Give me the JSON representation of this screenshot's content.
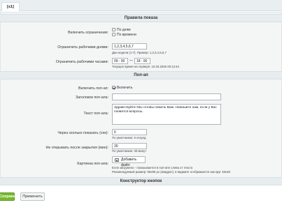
{
  "tab": {
    "label": "[s1]"
  },
  "sections": {
    "display_rules": "Правила показа",
    "popup": "Поп-ап",
    "buttons": "Конструктор кнопок"
  },
  "restrictions": {
    "label": "Включить ограничения:",
    "options": [
      {
        "label": "По дням",
        "checked": false
      },
      {
        "label": "По времени",
        "checked": false
      }
    ]
  },
  "workdays": {
    "label": "Ограничить рабочими днями:",
    "value": "1,2,3,4,5,6,7",
    "hint": "Дни недели (1-7). Пример: 1,2,3,4,5,6,7"
  },
  "workhours": {
    "label": "Ограничить рабочими часами:",
    "from": "09 : 00",
    "to": "18 : 00",
    "dash": "—",
    "hint": "Текущее время на сервере: 10.03.2026 00:12:44"
  },
  "popup_enable": {
    "label": "Включить поп-ап:",
    "option": "Включить",
    "checked": true
  },
  "popup_title": {
    "label": "Заголовок поп-апа:",
    "value": ""
  },
  "popup_text": {
    "label": "Текст поп-апа:",
    "value": "Здравствуйте! Мы готовы помочь Вам. Напишите нам, если у Вас появятся вопросы."
  },
  "show_after": {
    "label": "Через сколько показать (сек):",
    "value": "6",
    "hint": "По умолчанию: 6 секунд"
  },
  "hide_after_close": {
    "label": "Не открывать после закрытия (мин):",
    "value": "30",
    "hint": "По умолчанию: 30 минут"
  },
  "popup_image": {
    "label": "Картинка поп-апа:",
    "button": "Добавить файл",
    "hint1": "Если загружено - показывается в поп-апе слева от текста",
    "hint2": "Рекомендуемый размер: 96x96 px (квадрат), в видмите отображается как круг 48x48"
  },
  "footer": {
    "save": "Сохранить",
    "apply": "Применить"
  },
  "colors": {
    "save_button": "#79b930",
    "panel_bg": "#f4f6f6",
    "section_bg": "#e7ecee"
  }
}
